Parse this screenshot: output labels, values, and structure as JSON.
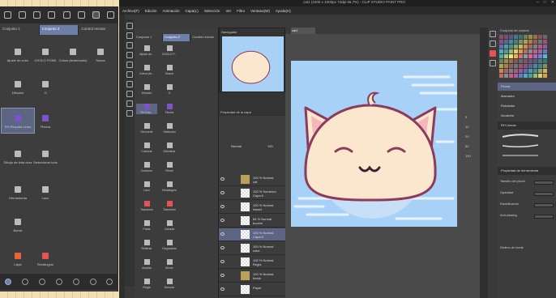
{
  "app": {
    "title": "cat1 (1000 x 1000px 72dpi 66.7%) - CLIP STUDIO PAINT PRO",
    "menu": [
      "Archivo(F)",
      "Edición",
      "Animación",
      "Capa(L)",
      "Selección",
      "Ver",
      "Filtro",
      "Ventana(W)",
      "Ayuda(H)"
    ],
    "window_controls": [
      "–",
      "□",
      "✕"
    ]
  },
  "zoom_panel": {
    "tabs": [
      "Conjunto 1",
      "Conjunto 2",
      "Control remoto"
    ],
    "active_tab": "Conjunto 2",
    "tools": [
      {
        "label": "Ajuste de color"
      },
      {
        "label": "CHOLO POND"
      },
      {
        "label": "Cubos (texturizado)"
      },
      {
        "label": "Suave"
      },
      {
        "label": "Difusión"
      },
      {
        "label": "G"
      },
      {
        "label": "RH Etiqueta Linea",
        "selected": true
      },
      {
        "label": "Flecha"
      },
      {
        "label": "Dibujo de tinta dura"
      },
      {
        "label": "Seleccionar todo"
      },
      {
        "label": "Herramienta"
      },
      {
        "label": "Lazo"
      },
      {
        "label": "Borrar"
      },
      {
        "label": "Lápiz"
      },
      {
        "label": "Rectángulo"
      }
    ]
  },
  "subtool_panel": {
    "tabs": [
      "Conjunto 1",
      "Conjunto 2",
      "Control remoto"
    ],
    "tools": [
      "Ajuste de...",
      "CHOLO P...",
      "Cubos (te...",
      "Suave",
      "Difusión",
      "G",
      "RH Etiq...",
      "Flecha",
      "Sin borde",
      "Selección",
      "Colorear",
      "Difuminar",
      "Contorno",
      "Pincel",
      "Lazo",
      "Rectángulo",
      "Transform",
      "Transform",
      "Pasar",
      "Canadá",
      "Rellenar",
      "Degradado",
      "Ampliar",
      "Mover",
      "Regla",
      "Decorar"
    ]
  },
  "navigator": {
    "label": "Navegador"
  },
  "canvas_tab": {
    "label": "cat1"
  },
  "layers": {
    "header": "Propiedad de la capa",
    "blend_mode": "Normal",
    "opacity": "100",
    "items": [
      {
        "name": "100 % Normal\ncat",
        "type": "folder"
      },
      {
        "name": "100 % Sombreo\nCapa 6"
      },
      {
        "name": "100 % Normal\nlineart"
      },
      {
        "name": "84 % Normal\nboceto"
      },
      {
        "name": "100 % Normal\nCapa 5",
        "selected": true
      },
      {
        "name": "100 % Normal\ncolor"
      },
      {
        "name": "100 % Normal\nRegla"
      },
      {
        "name": "100 % Normal\nfondo",
        "type": "folder"
      },
      {
        "name": "Papel"
      }
    ]
  },
  "right_panel": {
    "palette_label": "Conjunto de colores",
    "items": [
      "Pluma",
      "Marcador",
      "Rotulador",
      "Acuarela"
    ],
    "brushes_label": "RH Lineas",
    "properties_label": "Propiedad de herramienta",
    "props": [
      "Tamaño del pincel",
      "Opacidad",
      "Estabilización",
      "Anti-aliasing"
    ],
    "footer": "Relleno de borde"
  },
  "zoom_levels": [
    "5",
    "10",
    "20",
    "50",
    "100"
  ],
  "colors": {
    "canvas_bg": "#a7d1f7",
    "accent": "#6d7fa8",
    "cat_body": "#fbe6ce",
    "cat_outline": "#8e3a5a"
  }
}
